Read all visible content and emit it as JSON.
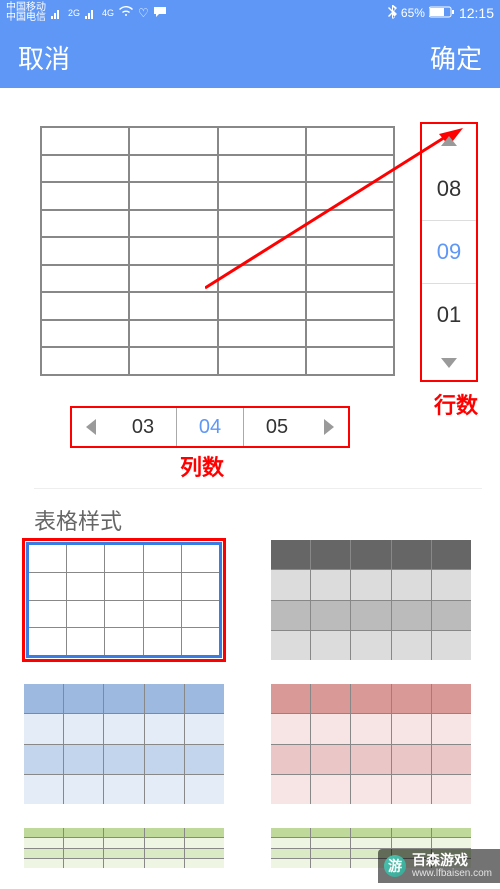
{
  "status": {
    "carrier1": "中国移动",
    "carrier2": "中国电信",
    "net1": "2G",
    "net2": "4G",
    "bluetooth_icon": "✱",
    "battery_pct": "65%",
    "time": "12:15"
  },
  "header": {
    "cancel": "取消",
    "confirm": "确定"
  },
  "row_spinner": {
    "prev": "08",
    "selected": "09",
    "next": "01",
    "label": "行数"
  },
  "col_spinner": {
    "prev": "03",
    "selected": "04",
    "next": "05",
    "label": "列数"
  },
  "preview": {
    "rows": 9,
    "cols": 4
  },
  "section_title": "表格样式",
  "style_thumbs": [
    {
      "name": "plain-white",
      "selected": true
    },
    {
      "name": "gray-banded"
    },
    {
      "name": "blue-banded"
    },
    {
      "name": "red-banded"
    },
    {
      "name": "green-banded-partial"
    },
    {
      "name": "teal-banded-partial"
    }
  ],
  "watermark": {
    "brand": "百森游戏",
    "url": "www.lfbaisen.com"
  }
}
